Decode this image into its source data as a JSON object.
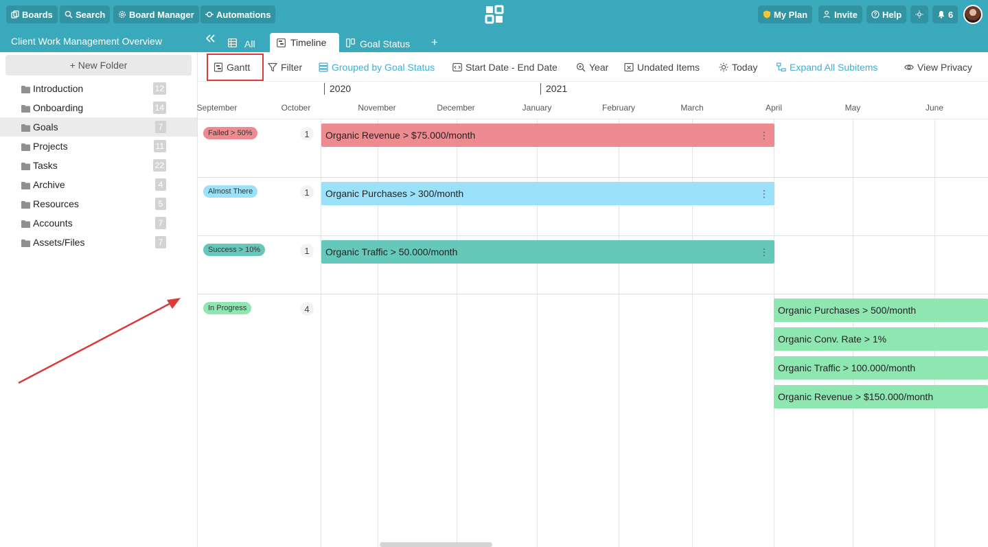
{
  "topbar": {
    "boards": "Boards",
    "search": "Search",
    "board_manager": "Board Manager",
    "automations": "Automations",
    "my_plan": "My Plan",
    "invite": "Invite",
    "help": "Help",
    "notifications_count": "6"
  },
  "project": {
    "title": "Client Work Management Overview"
  },
  "tabs": [
    {
      "label": "All"
    },
    {
      "label": "Timeline"
    },
    {
      "label": "Goal Status"
    }
  ],
  "sidebar": {
    "new_folder": "+ New Folder",
    "folders": [
      {
        "label": "Introduction",
        "count": "12"
      },
      {
        "label": "Onboarding",
        "count": "14"
      },
      {
        "label": "Goals",
        "count": "7"
      },
      {
        "label": "Projects",
        "count": "11"
      },
      {
        "label": "Tasks",
        "count": "22"
      },
      {
        "label": "Archive",
        "count": "4"
      },
      {
        "label": "Resources",
        "count": "5"
      },
      {
        "label": "Accounts",
        "count": "7"
      },
      {
        "label": "Assets/Files",
        "count": "7"
      }
    ]
  },
  "toolbar": {
    "gantt": "Gantt",
    "filter": "Filter",
    "grouped": "Grouped by Goal Status",
    "dates": "Start Date - End Date",
    "year": "Year",
    "undated": "Undated Items",
    "today": "Today",
    "expand": "Expand All Subitems",
    "privacy": "View Privacy"
  },
  "timeline": {
    "years": [
      "2020",
      "2021"
    ],
    "months": [
      "September",
      "October",
      "November",
      "December",
      "January",
      "February",
      "March",
      "April",
      "May",
      "June"
    ]
  },
  "groups": [
    {
      "label": "Failed > 50%",
      "count": "1",
      "color": "#ee8b91"
    },
    {
      "label": "Almost There",
      "count": "1",
      "color": "#9be1fa"
    },
    {
      "label": "Success > 10%",
      "count": "1",
      "color": "#66c7bb"
    },
    {
      "label": "In Progress",
      "count": "4",
      "color": "#8ee6b1"
    }
  ],
  "items": [
    {
      "label": "Organic Revenue > $75.000/month",
      "group": "Failed > 50%"
    },
    {
      "label": "Organic Purchases > 300/month",
      "group": "Almost There"
    },
    {
      "label": "Organic Traffic > 50.000/month",
      "group": "Success > 10%"
    },
    {
      "label": "Organic Purchases > 500/month",
      "group": "In Progress"
    },
    {
      "label": "Organic Conv. Rate > 1%",
      "group": "In Progress"
    },
    {
      "label": "Organic Traffic > 100.000/month",
      "group": "In Progress"
    },
    {
      "label": "Organic Revenue > $150.000/month",
      "group": "In Progress"
    }
  ],
  "colors": {
    "brand": "#3aa9bb",
    "annotation": "#d93a3a",
    "link_blue": "#3eaed4"
  }
}
